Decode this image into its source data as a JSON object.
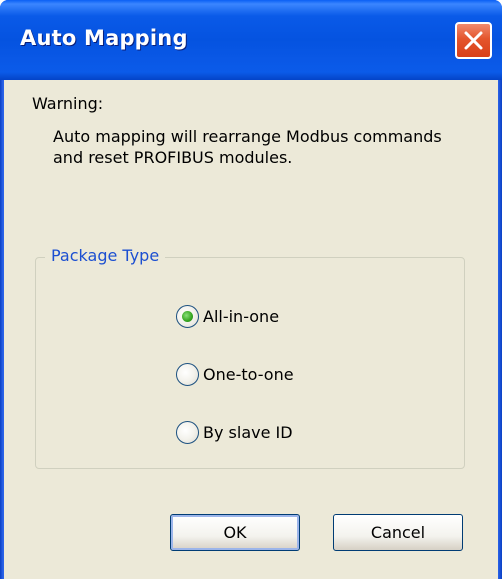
{
  "window": {
    "title": "Auto Mapping",
    "close_icon": "close-x-icon"
  },
  "warning": {
    "title": "Warning:",
    "message": "Auto mapping will rearrange Modbus commands and reset PROFIBUS modules."
  },
  "package_type": {
    "label": "Package Type",
    "options": [
      {
        "label": "All-in-one",
        "selected": true
      },
      {
        "label": "One-to-one",
        "selected": false
      },
      {
        "label": "By slave ID",
        "selected": false
      }
    ]
  },
  "buttons": {
    "ok_label": "OK",
    "cancel_label": "Cancel"
  },
  "colors": {
    "titlebar": "#0553e0",
    "client_bg": "#ece9d8",
    "group_label": "#1c4fd1",
    "close_button": "#e4552c",
    "radio_dot": "#34a41f"
  }
}
